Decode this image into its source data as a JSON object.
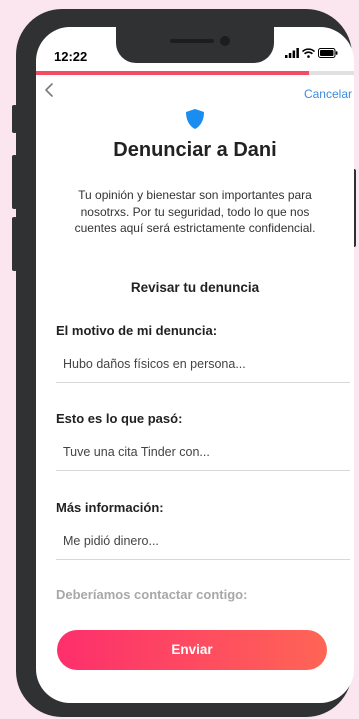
{
  "status_bar": {
    "time": "12:22"
  },
  "nav": {
    "back_icon": "chevron-left-icon",
    "cancel_label": "Cancelar"
  },
  "progress": {
    "fraction": 0.86
  },
  "header": {
    "icon": "shield-icon",
    "title": "Denunciar a Dani",
    "description": "Tu opinión y bienestar son importantes para nosotrxs. Por tu seguridad, todo lo que nos cuentes aquí será estrictamente confidencial.",
    "subtitle": "Revisar tu denuncia"
  },
  "sections": [
    {
      "label": "El motivo de mi denuncia:",
      "value": "Hubo daños físicos en persona..."
    },
    {
      "label": "Esto es lo que pasó:",
      "value": "Tuve una cita Tinder con..."
    },
    {
      "label": "Más información:",
      "value": "Me pidió dinero..."
    }
  ],
  "contact_label": "Deberíamos contactar contigo:",
  "submit_label": "Enviar",
  "colors": {
    "accent": "#f24d63",
    "link": "#3c8be0",
    "shield": "#1a8ef0",
    "background": "#fbe6ef"
  }
}
